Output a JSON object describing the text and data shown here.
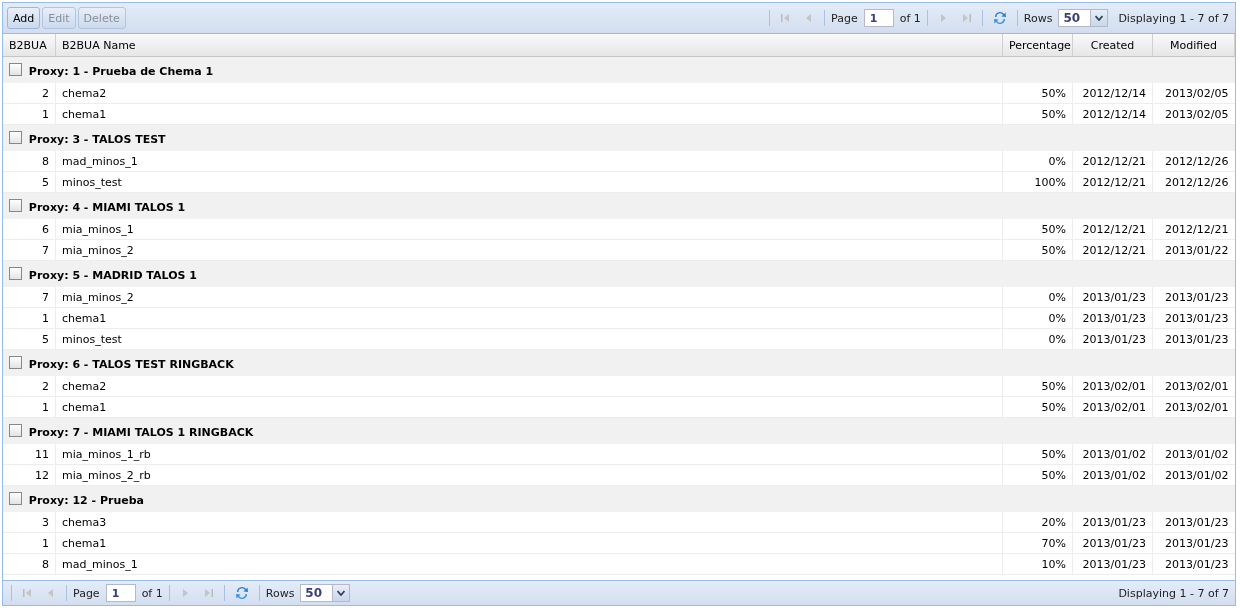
{
  "toolbar": {
    "buttons": [
      {
        "label": "Add",
        "disabled": false
      },
      {
        "label": "Edit",
        "disabled": true
      },
      {
        "label": "Delete",
        "disabled": true
      }
    ]
  },
  "pager_top": {
    "page_label": "Page",
    "page": "1",
    "of": "of 1",
    "rows_label": "Rows",
    "rows": "50",
    "display": "Displaying 1 - 7 of 7"
  },
  "table": {
    "columns": [
      "B2BUA",
      "B2BUA Name",
      "Percentage",
      "Created",
      "Modified"
    ],
    "groups": [
      {
        "title": "Proxy: 1 - Prueba de Chema 1",
        "checked": false,
        "rows": [
          [
            "2",
            "chema2",
            "50%",
            "2012/12/14",
            "2013/02/05"
          ],
          [
            "1",
            "chema1",
            "50%",
            "2012/12/14",
            "2013/02/05"
          ]
        ]
      },
      {
        "title": "Proxy: 3 - TALOS TEST",
        "checked": false,
        "rows": [
          [
            "8",
            "mad_minos_1",
            "0%",
            "2012/12/21",
            "2012/12/26"
          ],
          [
            "5",
            "minos_test",
            "100%",
            "2012/12/21",
            "2012/12/26"
          ]
        ]
      },
      {
        "title": "Proxy: 4 - MIAMI TALOS 1",
        "checked": false,
        "rows": [
          [
            "6",
            "mia_minos_1",
            "50%",
            "2012/12/21",
            "2012/12/21"
          ],
          [
            "7",
            "mia_minos_2",
            "50%",
            "2012/12/21",
            "2013/01/22"
          ]
        ]
      },
      {
        "title": "Proxy: 5 - MADRID TALOS 1",
        "checked": false,
        "rows": [
          [
            "7",
            "mia_minos_2",
            "0%",
            "2013/01/23",
            "2013/01/23"
          ],
          [
            "1",
            "chema1",
            "0%",
            "2013/01/23",
            "2013/01/23"
          ],
          [
            "5",
            "minos_test",
            "0%",
            "2013/01/23",
            "2013/01/23"
          ]
        ]
      },
      {
        "title": "Proxy: 6 - TALOS TEST RINGBACK",
        "checked": false,
        "rows": [
          [
            "2",
            "chema2",
            "50%",
            "2013/02/01",
            "2013/02/01"
          ],
          [
            "1",
            "chema1",
            "50%",
            "2013/02/01",
            "2013/02/01"
          ]
        ]
      },
      {
        "title": "Proxy: 7 - MIAMI TALOS 1 RINGBACK",
        "checked": false,
        "rows": [
          [
            "11",
            "mia_minos_1_rb",
            "50%",
            "2013/01/02",
            "2013/01/02"
          ],
          [
            "12",
            "mia_minos_2_rb",
            "50%",
            "2013/01/02",
            "2013/01/02"
          ]
        ]
      },
      {
        "title": "Proxy: 12 - Prueba",
        "checked": false,
        "rows": [
          [
            "3",
            "chema3",
            "20%",
            "2013/01/23",
            "2013/01/23"
          ],
          [
            "1",
            "chema1",
            "70%",
            "2013/01/23",
            "2013/01/23"
          ],
          [
            "8",
            "mad_minos_1",
            "10%",
            "2013/01/23",
            "2013/01/23"
          ]
        ]
      }
    ]
  },
  "pager_bottom": {
    "page_label": "Page",
    "page": "1",
    "of": "of 1",
    "rows_label": "Rows",
    "rows": "50",
    "display": "Displaying 1 - 7 of 7"
  }
}
